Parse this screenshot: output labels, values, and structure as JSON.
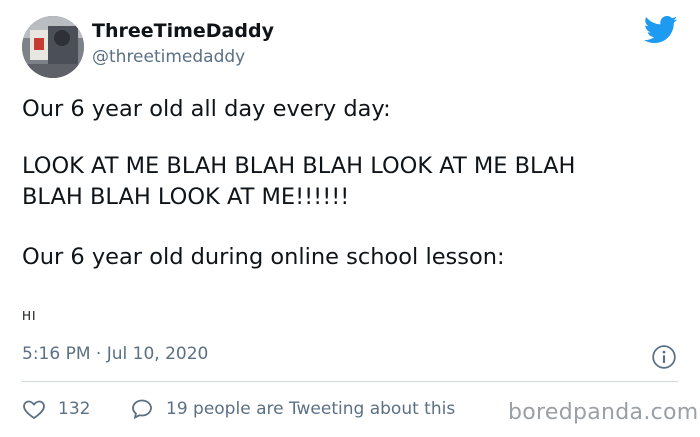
{
  "tweet": {
    "display_name": "ThreeTimeDaddy",
    "handle": "@threetimedaddy",
    "lines": [
      "Our 6 year old all day every day:",
      "LOOK AT ME BLAH BLAH BLAH LOOK AT ME BLAH",
      "BLAH BLAH LOOK AT ME!!!!!!",
      "Our 6 year old during online school lesson:"
    ],
    "small_text": "HI",
    "timestamp": "5:16 PM · Jul 10, 2020",
    "likes": "132",
    "discussion": "19 people are Tweeting about this"
  },
  "watermark": "boredpanda.com",
  "icons": {
    "brand": "twitter-bird-icon",
    "info": "info-icon",
    "like": "heart-icon",
    "reply": "speech-bubble-icon"
  },
  "colors": {
    "twitter_blue": "#1d9bf0",
    "text": "#0f1419",
    "muted": "#5b7083"
  }
}
